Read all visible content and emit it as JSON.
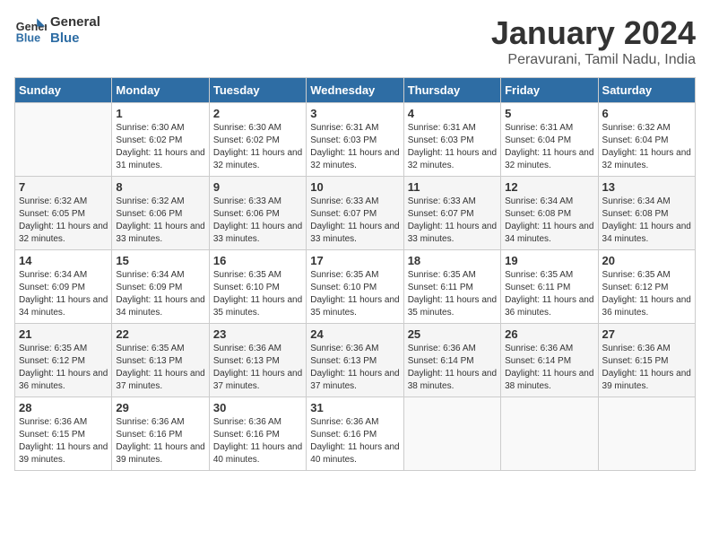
{
  "logo": {
    "line1": "General",
    "line2": "Blue"
  },
  "title": "January 2024",
  "subtitle": "Peravurani, Tamil Nadu, India",
  "days_of_week": [
    "Sunday",
    "Monday",
    "Tuesday",
    "Wednesday",
    "Thursday",
    "Friday",
    "Saturday"
  ],
  "weeks": [
    [
      {
        "num": "",
        "sunrise": "",
        "sunset": "",
        "daylight": "",
        "empty": true
      },
      {
        "num": "1",
        "sunrise": "Sunrise: 6:30 AM",
        "sunset": "Sunset: 6:02 PM",
        "daylight": "Daylight: 11 hours and 31 minutes."
      },
      {
        "num": "2",
        "sunrise": "Sunrise: 6:30 AM",
        "sunset": "Sunset: 6:02 PM",
        "daylight": "Daylight: 11 hours and 32 minutes."
      },
      {
        "num": "3",
        "sunrise": "Sunrise: 6:31 AM",
        "sunset": "Sunset: 6:03 PM",
        "daylight": "Daylight: 11 hours and 32 minutes."
      },
      {
        "num": "4",
        "sunrise": "Sunrise: 6:31 AM",
        "sunset": "Sunset: 6:03 PM",
        "daylight": "Daylight: 11 hours and 32 minutes."
      },
      {
        "num": "5",
        "sunrise": "Sunrise: 6:31 AM",
        "sunset": "Sunset: 6:04 PM",
        "daylight": "Daylight: 11 hours and 32 minutes."
      },
      {
        "num": "6",
        "sunrise": "Sunrise: 6:32 AM",
        "sunset": "Sunset: 6:04 PM",
        "daylight": "Daylight: 11 hours and 32 minutes."
      }
    ],
    [
      {
        "num": "7",
        "sunrise": "Sunrise: 6:32 AM",
        "sunset": "Sunset: 6:05 PM",
        "daylight": "Daylight: 11 hours and 32 minutes."
      },
      {
        "num": "8",
        "sunrise": "Sunrise: 6:32 AM",
        "sunset": "Sunset: 6:06 PM",
        "daylight": "Daylight: 11 hours and 33 minutes."
      },
      {
        "num": "9",
        "sunrise": "Sunrise: 6:33 AM",
        "sunset": "Sunset: 6:06 PM",
        "daylight": "Daylight: 11 hours and 33 minutes."
      },
      {
        "num": "10",
        "sunrise": "Sunrise: 6:33 AM",
        "sunset": "Sunset: 6:07 PM",
        "daylight": "Daylight: 11 hours and 33 minutes."
      },
      {
        "num": "11",
        "sunrise": "Sunrise: 6:33 AM",
        "sunset": "Sunset: 6:07 PM",
        "daylight": "Daylight: 11 hours and 33 minutes."
      },
      {
        "num": "12",
        "sunrise": "Sunrise: 6:34 AM",
        "sunset": "Sunset: 6:08 PM",
        "daylight": "Daylight: 11 hours and 34 minutes."
      },
      {
        "num": "13",
        "sunrise": "Sunrise: 6:34 AM",
        "sunset": "Sunset: 6:08 PM",
        "daylight": "Daylight: 11 hours and 34 minutes."
      }
    ],
    [
      {
        "num": "14",
        "sunrise": "Sunrise: 6:34 AM",
        "sunset": "Sunset: 6:09 PM",
        "daylight": "Daylight: 11 hours and 34 minutes."
      },
      {
        "num": "15",
        "sunrise": "Sunrise: 6:34 AM",
        "sunset": "Sunset: 6:09 PM",
        "daylight": "Daylight: 11 hours and 34 minutes."
      },
      {
        "num": "16",
        "sunrise": "Sunrise: 6:35 AM",
        "sunset": "Sunset: 6:10 PM",
        "daylight": "Daylight: 11 hours and 35 minutes."
      },
      {
        "num": "17",
        "sunrise": "Sunrise: 6:35 AM",
        "sunset": "Sunset: 6:10 PM",
        "daylight": "Daylight: 11 hours and 35 minutes."
      },
      {
        "num": "18",
        "sunrise": "Sunrise: 6:35 AM",
        "sunset": "Sunset: 6:11 PM",
        "daylight": "Daylight: 11 hours and 35 minutes."
      },
      {
        "num": "19",
        "sunrise": "Sunrise: 6:35 AM",
        "sunset": "Sunset: 6:11 PM",
        "daylight": "Daylight: 11 hours and 36 minutes."
      },
      {
        "num": "20",
        "sunrise": "Sunrise: 6:35 AM",
        "sunset": "Sunset: 6:12 PM",
        "daylight": "Daylight: 11 hours and 36 minutes."
      }
    ],
    [
      {
        "num": "21",
        "sunrise": "Sunrise: 6:35 AM",
        "sunset": "Sunset: 6:12 PM",
        "daylight": "Daylight: 11 hours and 36 minutes."
      },
      {
        "num": "22",
        "sunrise": "Sunrise: 6:35 AM",
        "sunset": "Sunset: 6:13 PM",
        "daylight": "Daylight: 11 hours and 37 minutes."
      },
      {
        "num": "23",
        "sunrise": "Sunrise: 6:36 AM",
        "sunset": "Sunset: 6:13 PM",
        "daylight": "Daylight: 11 hours and 37 minutes."
      },
      {
        "num": "24",
        "sunrise": "Sunrise: 6:36 AM",
        "sunset": "Sunset: 6:13 PM",
        "daylight": "Daylight: 11 hours and 37 minutes."
      },
      {
        "num": "25",
        "sunrise": "Sunrise: 6:36 AM",
        "sunset": "Sunset: 6:14 PM",
        "daylight": "Daylight: 11 hours and 38 minutes."
      },
      {
        "num": "26",
        "sunrise": "Sunrise: 6:36 AM",
        "sunset": "Sunset: 6:14 PM",
        "daylight": "Daylight: 11 hours and 38 minutes."
      },
      {
        "num": "27",
        "sunrise": "Sunrise: 6:36 AM",
        "sunset": "Sunset: 6:15 PM",
        "daylight": "Daylight: 11 hours and 39 minutes."
      }
    ],
    [
      {
        "num": "28",
        "sunrise": "Sunrise: 6:36 AM",
        "sunset": "Sunset: 6:15 PM",
        "daylight": "Daylight: 11 hours and 39 minutes."
      },
      {
        "num": "29",
        "sunrise": "Sunrise: 6:36 AM",
        "sunset": "Sunset: 6:16 PM",
        "daylight": "Daylight: 11 hours and 39 minutes."
      },
      {
        "num": "30",
        "sunrise": "Sunrise: 6:36 AM",
        "sunset": "Sunset: 6:16 PM",
        "daylight": "Daylight: 11 hours and 40 minutes."
      },
      {
        "num": "31",
        "sunrise": "Sunrise: 6:36 AM",
        "sunset": "Sunset: 6:16 PM",
        "daylight": "Daylight: 11 hours and 40 minutes."
      },
      {
        "num": "",
        "sunrise": "",
        "sunset": "",
        "daylight": "",
        "empty": true
      },
      {
        "num": "",
        "sunrise": "",
        "sunset": "",
        "daylight": "",
        "empty": true
      },
      {
        "num": "",
        "sunrise": "",
        "sunset": "",
        "daylight": "",
        "empty": true
      }
    ]
  ]
}
